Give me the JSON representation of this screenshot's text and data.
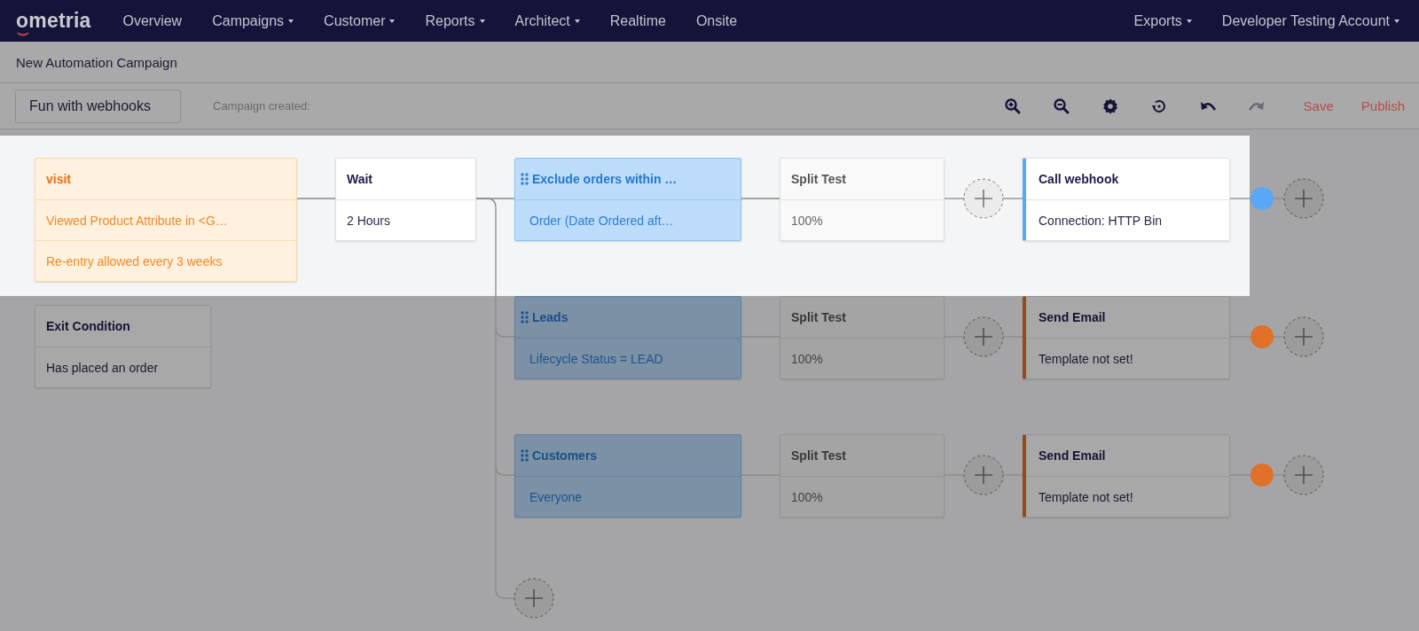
{
  "nav": {
    "logo": "ometria",
    "items": [
      {
        "label": "Overview",
        "dropdown": false
      },
      {
        "label": "Campaigns",
        "dropdown": true
      },
      {
        "label": "Customer",
        "dropdown": true
      },
      {
        "label": "Reports",
        "dropdown": true
      },
      {
        "label": "Architect",
        "dropdown": true
      },
      {
        "label": "Realtime",
        "dropdown": false
      },
      {
        "label": "Onsite",
        "dropdown": false
      }
    ],
    "right": [
      {
        "label": "Exports",
        "dropdown": true
      },
      {
        "label": "Developer Testing Account",
        "dropdown": true
      }
    ]
  },
  "page_title": "New Automation Campaign",
  "toolbar": {
    "campaign_name": "Fun with webhooks",
    "created_label": "Campaign created:",
    "tools": [
      {
        "kind": "zoom-in",
        "disabled": false
      },
      {
        "kind": "zoom-out",
        "disabled": false
      },
      {
        "kind": "settings",
        "disabled": false
      },
      {
        "kind": "history",
        "disabled": false
      },
      {
        "kind": "undo",
        "disabled": false
      },
      {
        "kind": "redo",
        "disabled": true
      }
    ],
    "save": "Save",
    "publish": "Publish"
  },
  "entry": {
    "highlighted": true,
    "title": "visit",
    "rows": [
      "Viewed Product Attribute in <G…",
      "Re-entry allowed every 3 weeks"
    ]
  },
  "exit": {
    "highlighted": false,
    "title": "Exit Condition",
    "body": "Has placed an order"
  },
  "wait": {
    "highlighted": true,
    "title": "Wait",
    "body": "2 Hours"
  },
  "branches": [
    {
      "highlighted": true,
      "segment": {
        "title": "Exclude orders within …",
        "body": "Order (Date Ordered aft…"
      },
      "split": {
        "title": "Split Test",
        "body": "100%"
      },
      "action": {
        "title": "Call webhook",
        "body": "Connection: HTTP Bin",
        "color": "#5aa7f5"
      }
    },
    {
      "highlighted": false,
      "segment": {
        "title": "Leads",
        "body": "Lifecycle Status = LEAD"
      },
      "split": {
        "title": "Split Test",
        "body": "100%"
      },
      "action": {
        "title": "Send Email",
        "body": "Template not set!",
        "color": "#e0702a"
      }
    },
    {
      "highlighted": false,
      "segment": {
        "title": "Customers",
        "body": "Everyone"
      },
      "split": {
        "title": "Split Test",
        "body": "100%"
      },
      "action": {
        "title": "Send Email",
        "body": "Template not set!",
        "color": "#e0702a"
      }
    }
  ]
}
